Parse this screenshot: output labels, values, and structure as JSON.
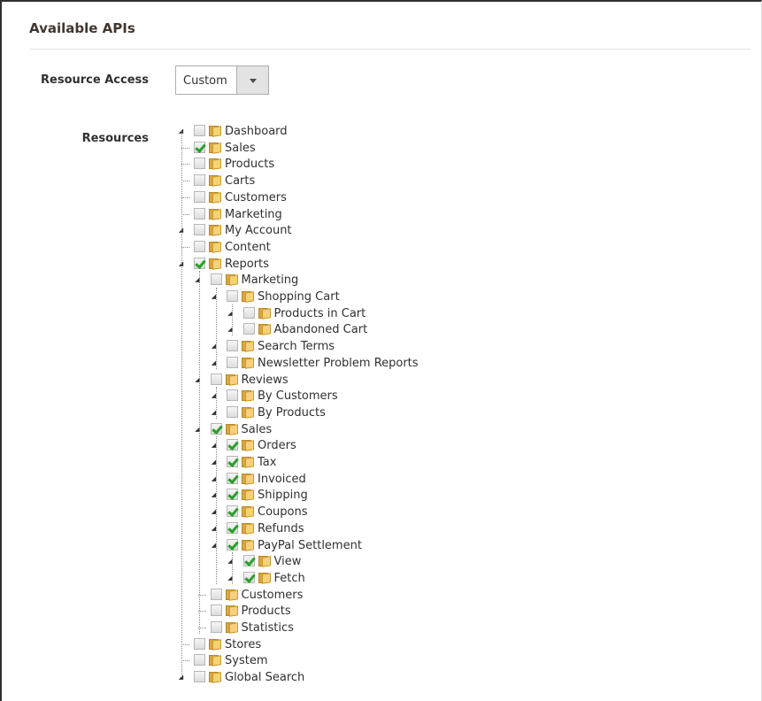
{
  "section": {
    "title": "Available APIs"
  },
  "resource_access": {
    "label": "Resource Access",
    "value": "Custom"
  },
  "resources": {
    "label": "Resources",
    "tree": [
      {
        "label": "Dashboard",
        "checked": false,
        "expander": "leaf",
        "children": []
      },
      {
        "label": "Sales",
        "checked": true,
        "expander": "collapsed",
        "children": []
      },
      {
        "label": "Products",
        "checked": false,
        "expander": "collapsed",
        "children": []
      },
      {
        "label": "Carts",
        "checked": false,
        "expander": "collapsed",
        "children": []
      },
      {
        "label": "Customers",
        "checked": false,
        "expander": "collapsed",
        "children": []
      },
      {
        "label": "Marketing",
        "checked": false,
        "expander": "collapsed",
        "children": []
      },
      {
        "label": "My Account",
        "checked": false,
        "expander": "leaf",
        "children": []
      },
      {
        "label": "Content",
        "checked": false,
        "expander": "collapsed",
        "children": []
      },
      {
        "label": "Reports",
        "checked": true,
        "expander": "expanded",
        "children": [
          {
            "label": "Marketing",
            "checked": false,
            "expander": "expanded",
            "children": [
              {
                "label": "Shopping Cart",
                "checked": false,
                "expander": "expanded",
                "children": [
                  {
                    "label": "Products in Cart",
                    "checked": false,
                    "expander": "leaf",
                    "children": []
                  },
                  {
                    "label": "Abandoned Cart",
                    "checked": false,
                    "expander": "leaf",
                    "children": []
                  }
                ]
              },
              {
                "label": "Search Terms",
                "checked": false,
                "expander": "leaf",
                "children": []
              },
              {
                "label": "Newsletter Problem Reports",
                "checked": false,
                "expander": "leaf",
                "children": []
              }
            ]
          },
          {
            "label": "Reviews",
            "checked": false,
            "expander": "expanded",
            "children": [
              {
                "label": "By Customers",
                "checked": false,
                "expander": "leaf",
                "children": []
              },
              {
                "label": "By Products",
                "checked": false,
                "expander": "leaf",
                "children": []
              }
            ]
          },
          {
            "label": "Sales",
            "checked": true,
            "expander": "expanded",
            "children": [
              {
                "label": "Orders",
                "checked": true,
                "expander": "leaf",
                "children": []
              },
              {
                "label": "Tax",
                "checked": true,
                "expander": "leaf",
                "children": []
              },
              {
                "label": "Invoiced",
                "checked": true,
                "expander": "leaf",
                "children": []
              },
              {
                "label": "Shipping",
                "checked": true,
                "expander": "leaf",
                "children": []
              },
              {
                "label": "Coupons",
                "checked": true,
                "expander": "leaf",
                "children": []
              },
              {
                "label": "Refunds",
                "checked": true,
                "expander": "leaf",
                "children": []
              },
              {
                "label": "PayPal Settlement",
                "checked": true,
                "expander": "expanded",
                "children": [
                  {
                    "label": "View",
                    "checked": true,
                    "expander": "leaf",
                    "children": []
                  },
                  {
                    "label": "Fetch",
                    "checked": true,
                    "expander": "leaf",
                    "children": []
                  }
                ]
              }
            ]
          },
          {
            "label": "Customers",
            "checked": false,
            "expander": "collapsed",
            "children": []
          },
          {
            "label": "Products",
            "checked": false,
            "expander": "collapsed",
            "children": []
          },
          {
            "label": "Statistics",
            "checked": false,
            "expander": "collapsed",
            "children": []
          }
        ]
      },
      {
        "label": "Stores",
        "checked": false,
        "expander": "collapsed",
        "children": []
      },
      {
        "label": "System",
        "checked": false,
        "expander": "collapsed",
        "children": []
      },
      {
        "label": "Global Search",
        "checked": false,
        "expander": "leaf",
        "children": []
      }
    ]
  }
}
